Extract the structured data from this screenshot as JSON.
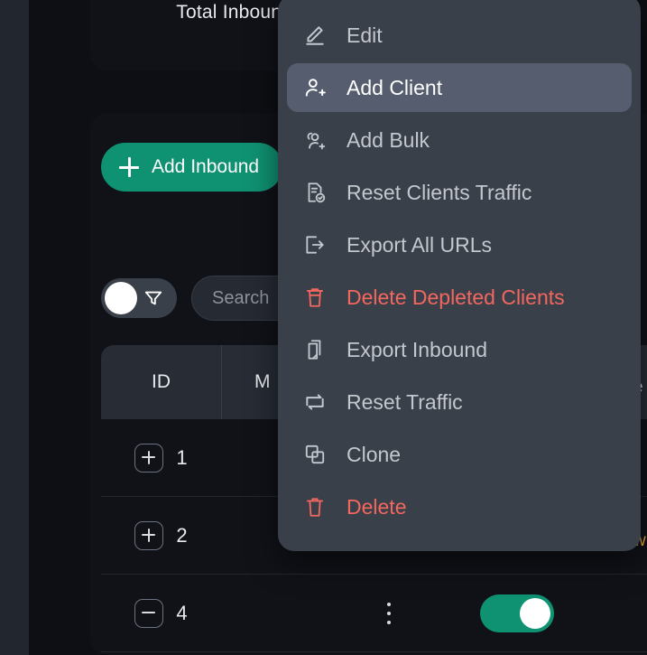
{
  "background": {
    "stat_card": {
      "title": "Total Inbounds"
    },
    "add_inbound_button": {
      "label": "Add Inbound",
      "icon": "plus-icon",
      "color": "#0f9272"
    },
    "filter_toggle": {
      "icon": "funnel-icon",
      "state": "off"
    },
    "search": {
      "placeholder": "Search",
      "value": ""
    },
    "table": {
      "columns": [
        "ID",
        "M"
      ],
      "rows": [
        {
          "id": "1",
          "expander": "plus-icon"
        },
        {
          "id": "2",
          "expander": "plus-icon"
        },
        {
          "id": "4",
          "expander": "minus-icon",
          "kebab": "kebab-icon",
          "enabled_toggle": "on"
        }
      ]
    },
    "clipped_edge_text": {
      "top": "e",
      "bottom": "w"
    }
  },
  "context_menu": {
    "highlight_color": "#555d6e",
    "panel_color": "#3a4049",
    "danger_color": "#f2675e",
    "items": [
      {
        "label": "Edit",
        "icon": "pencil-icon",
        "danger": false,
        "active": false
      },
      {
        "label": "Add Client",
        "icon": "user-plus-icon",
        "danger": false,
        "active": true
      },
      {
        "label": "Add Bulk",
        "icon": "users-plus-icon",
        "danger": false,
        "active": false
      },
      {
        "label": "Reset Clients Traffic",
        "icon": "file-check-icon",
        "danger": false,
        "active": false
      },
      {
        "label": "Export All URLs",
        "icon": "export-arrow-icon",
        "danger": false,
        "active": false
      },
      {
        "label": "Delete Depleted Clients",
        "icon": "trash-lid-icon",
        "danger": true,
        "active": false
      },
      {
        "label": "Export Inbound",
        "icon": "copy-file-icon",
        "danger": false,
        "active": false
      },
      {
        "label": "Reset Traffic",
        "icon": "repeat-icon",
        "danger": false,
        "active": false
      },
      {
        "label": "Clone",
        "icon": "clone-squares-icon",
        "danger": false,
        "active": false
      },
      {
        "label": "Delete",
        "icon": "trash-icon",
        "danger": true,
        "active": false
      }
    ]
  }
}
